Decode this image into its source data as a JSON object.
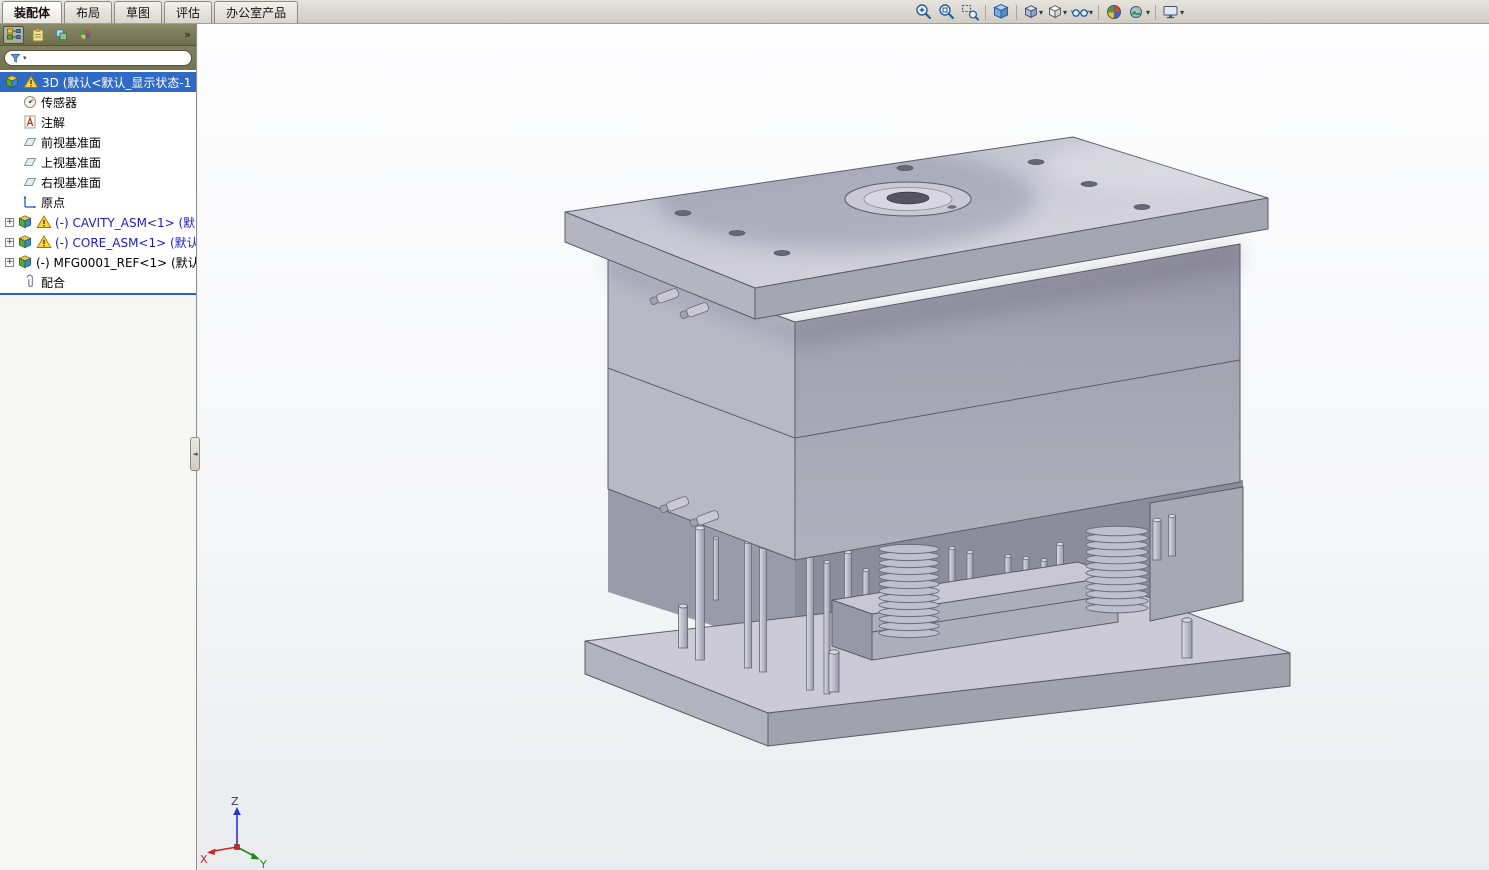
{
  "ribbon": {
    "tabs": [
      {
        "label": "装配体",
        "active": true
      },
      {
        "label": "布局",
        "active": false
      },
      {
        "label": "草图",
        "active": false
      },
      {
        "label": "评估",
        "active": false
      },
      {
        "label": "办公室产品",
        "active": false
      }
    ]
  },
  "view_toolbar": {
    "tools": [
      "zoom-in",
      "zoom-to-fit",
      "zoom-to-area",
      "3d-view",
      "view-orientation",
      "display-style",
      "hide-show-items",
      "edit-appearance",
      "apply-scene",
      "view-settings"
    ]
  },
  "feature_manager": {
    "overflow": "»",
    "filter_placeholder": "",
    "items": [
      {
        "label": "3D (默认<默认_显示状态-1",
        "icon": "assembly",
        "warning": true,
        "selected": true
      },
      {
        "label": "传感器",
        "icon": "sensors"
      },
      {
        "label": "注解",
        "icon": "annotations"
      },
      {
        "label": "前视基准面",
        "icon": "plane"
      },
      {
        "label": "上视基准面",
        "icon": "plane"
      },
      {
        "label": "右视基准面",
        "icon": "plane"
      },
      {
        "label": "原点",
        "icon": "origin"
      },
      {
        "label": "(-) CAVITY_ASM<1> (默",
        "icon": "assembly",
        "warning": true,
        "expandable": true,
        "link": true
      },
      {
        "label": "(-) CORE_ASM<1> (默认",
        "icon": "assembly",
        "warning": true,
        "expandable": true,
        "link": true
      },
      {
        "label": "(-) MFG0001_REF<1> (默认",
        "icon": "assembly",
        "expandable": true,
        "link": false
      },
      {
        "label": "配合",
        "icon": "mates"
      }
    ]
  },
  "ui_glyphs": {
    "expander": "+",
    "caret": "▾",
    "collapse_left": "◄"
  },
  "triad": {
    "x": "X",
    "y": "Y",
    "z": "Z"
  },
  "colors": {
    "selection_blue": "#316ac5",
    "panel_chrome": "#73734f",
    "tree_link_blue": "#1d1dbd",
    "accent_line": "#2a5fd0",
    "model_top": "#d2d1dc",
    "model_left": "#b6b5c2",
    "model_right": "#a4a3b0"
  }
}
